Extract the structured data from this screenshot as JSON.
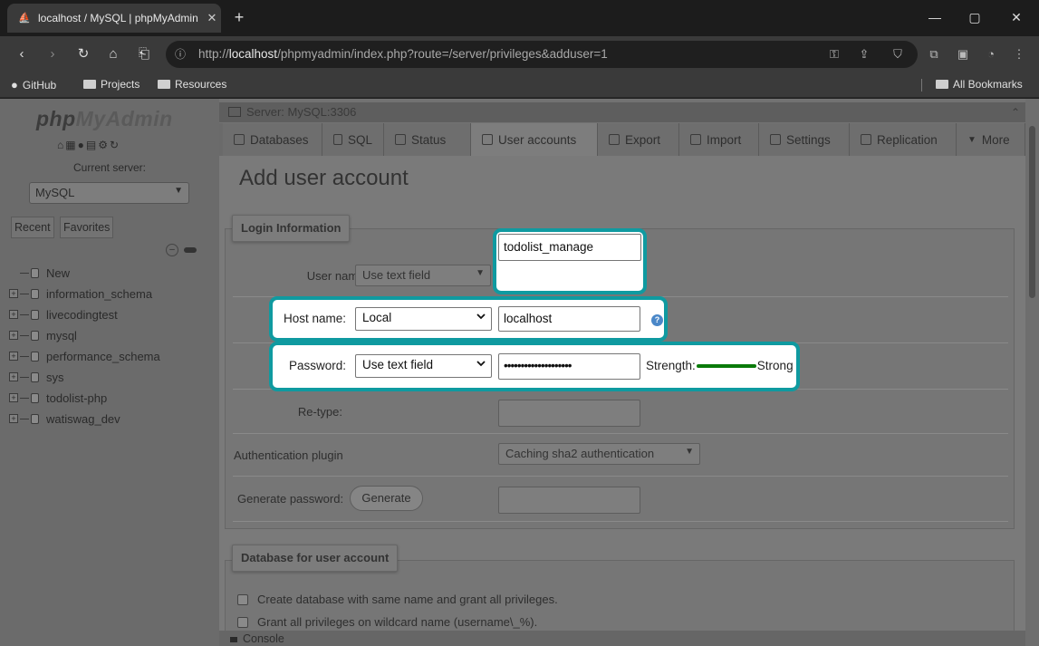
{
  "browser": {
    "tab_title": "localhost / MySQL | phpMyAdmin",
    "url_host": "localhost",
    "url_prefix": "http://",
    "url_path": "/phpmyadmin/index.php?route=/server/privileges&adduser=1",
    "bookmarks": [
      "GitHub",
      "Projects",
      "Resources"
    ],
    "all_bookmarks": "All Bookmarks"
  },
  "sidebar": {
    "logo_php": "php",
    "logo_myadmin": "MyAdmin",
    "current_server_label": "Current server:",
    "server_select": "MySQL",
    "tabs": [
      "Recent",
      "Favorites"
    ],
    "tree": [
      "New",
      "information_schema",
      "livecodingtest",
      "mysql",
      "performance_schema",
      "sys",
      "todolist-php",
      "watiswag_dev"
    ]
  },
  "main": {
    "server_bar": "Server: MySQL:3306",
    "menu": [
      "Databases",
      "SQL",
      "Status",
      "User accounts",
      "Export",
      "Import",
      "Settings",
      "Replication",
      "More"
    ],
    "active_menu": "User accounts",
    "page_title": "Add user account",
    "login_legend": "Login Information",
    "user_name_label": "User name:",
    "user_name_type": "Use text field",
    "user_name_value": "todolist_manage",
    "host_name_label": "Host name:",
    "host_type": "Local",
    "host_value": "localhost",
    "password_label": "Password:",
    "password_type": "Use text field",
    "password_value": "••••••••••••••••••••",
    "strength_label": "Strength:",
    "strength_value": "Strong",
    "retype_label": "Re-type:",
    "auth_plugin_label": "Authentication plugin",
    "auth_plugin_value": "Caching sha2 authentication",
    "gen_password_label": "Generate password:",
    "generate_button": "Generate",
    "db_legend": "Database for user account",
    "db_options": [
      "Create database with same name and grant all privileges.",
      "Grant all privileges on wildcard name (username\\_%)."
    ],
    "console": "Console"
  },
  "colors": {
    "highlight": "#0f9aa0",
    "strength": "#0a7a0a"
  }
}
